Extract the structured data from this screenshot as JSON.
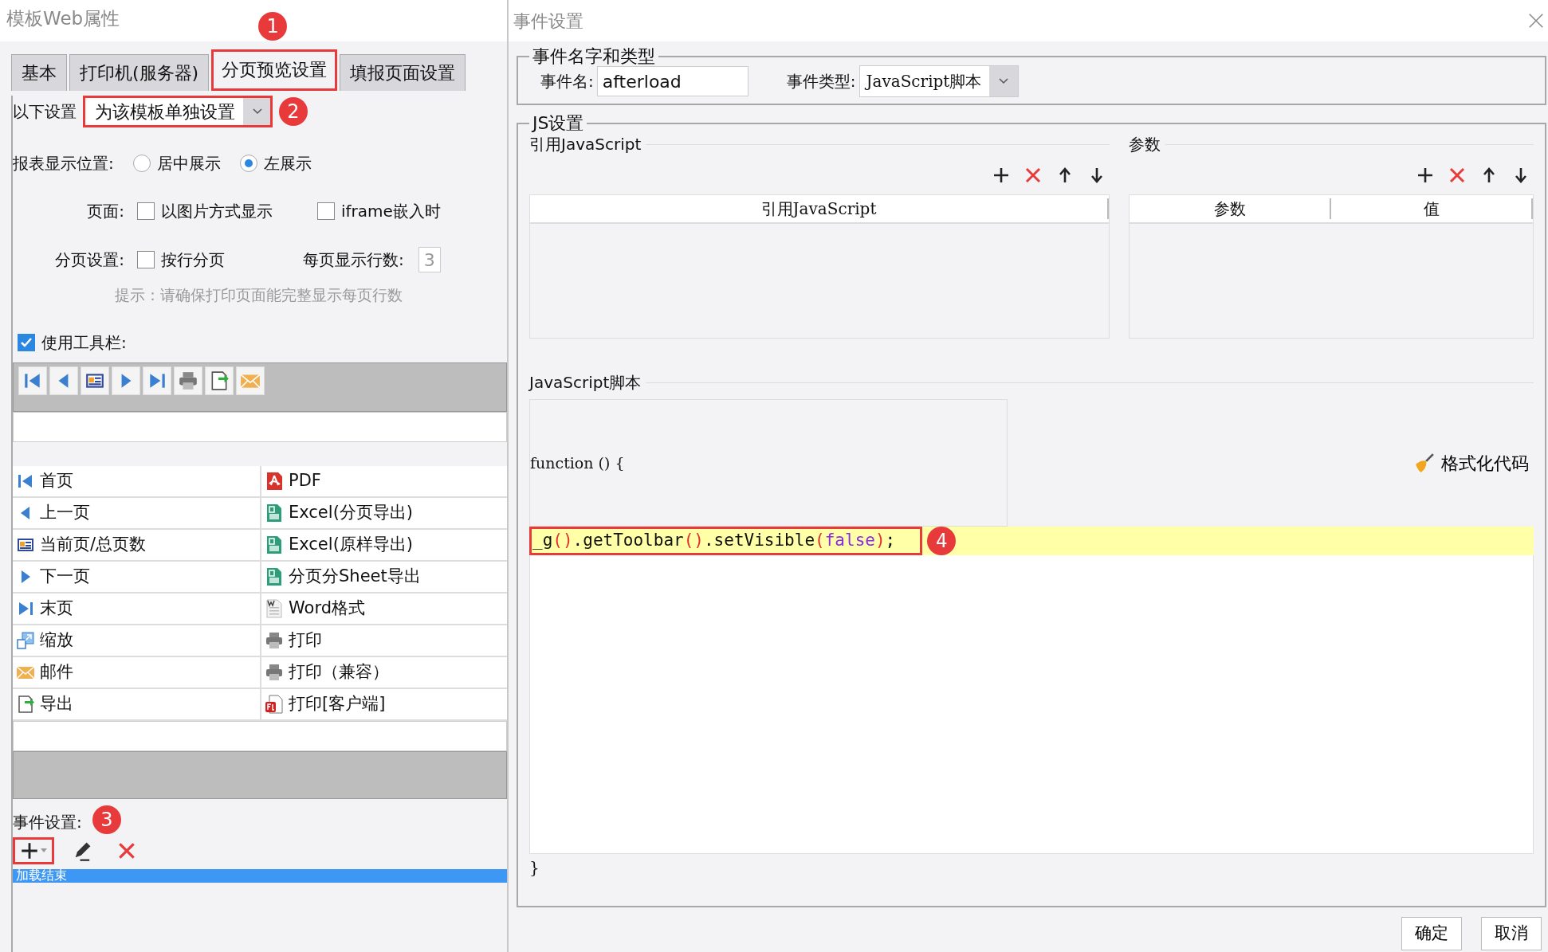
{
  "left_panel": {
    "title": "模板Web属性",
    "tabs": [
      {
        "label": "基本",
        "selected": false,
        "highlighted": false
      },
      {
        "label": "打印机(服务器)",
        "selected": false,
        "highlighted": false
      },
      {
        "label": "分页预览设置",
        "selected": true,
        "highlighted": true,
        "badge": "1"
      },
      {
        "label": "填报页面设置",
        "selected": false,
        "highlighted": false
      }
    ],
    "settings_for": {
      "label": "以下设置",
      "value": "为该模板单独设置",
      "highlighted": true,
      "badge": "2"
    },
    "display_position": {
      "label": "报表显示位置:",
      "options": [
        {
          "label": "居中展示",
          "selected": false
        },
        {
          "label": "左展示",
          "selected": true
        }
      ]
    },
    "page": {
      "label": "页面:",
      "options": [
        {
          "label": "以图片方式显示",
          "checked": false
        },
        {
          "label": "iframe嵌入时",
          "checked": false
        }
      ]
    },
    "paging": {
      "label": "分页设置:",
      "option": {
        "label": "按行分页",
        "checked": false
      },
      "rows_label": "每页显示行数:",
      "rows_value": "3"
    },
    "hint": "提示：请确保打印页面能完整显示每页行数",
    "use_toolbar": {
      "label": "使用工具栏:",
      "checked": true
    },
    "toolbar_preview": [
      {
        "kind": "first"
      },
      {
        "kind": "prev"
      },
      {
        "kind": "page"
      },
      {
        "kind": "next"
      },
      {
        "kind": "last"
      },
      {
        "kind": "print"
      },
      {
        "kind": "export"
      },
      {
        "kind": "email"
      }
    ],
    "toolbar_items_left": [
      {
        "kind": "first",
        "label": "首页"
      },
      {
        "kind": "prev",
        "label": "上一页"
      },
      {
        "kind": "page",
        "label": "当前页/总页数"
      },
      {
        "kind": "next",
        "label": "下一页"
      },
      {
        "kind": "last",
        "label": "末页"
      },
      {
        "kind": "zoom",
        "label": "缩放"
      },
      {
        "kind": "email",
        "label": "邮件"
      },
      {
        "kind": "export",
        "label": "导出"
      }
    ],
    "toolbar_items_right": [
      {
        "kind": "pdf",
        "label": "PDF"
      },
      {
        "kind": "excel",
        "label": "Excel(分页导出)"
      },
      {
        "kind": "excel",
        "label": "Excel(原样导出)"
      },
      {
        "kind": "excel",
        "label": "分页分Sheet导出"
      },
      {
        "kind": "word",
        "label": "Word格式"
      },
      {
        "kind": "print",
        "label": "打印"
      },
      {
        "kind": "print",
        "label": "打印（兼容）"
      },
      {
        "kind": "flash",
        "label": "打印[客户端]"
      }
    ],
    "events": {
      "label": "事件设置:",
      "badge": "3",
      "add_highlighted": true,
      "items": [
        {
          "label": "加载结束",
          "selected": true
        }
      ]
    }
  },
  "dialog": {
    "title": "事件设置",
    "name_type": {
      "legend": "事件名字和类型",
      "name_label": "事件名:",
      "name_value": "afterload",
      "type_label": "事件类型:",
      "type_value": "JavaScript脚本"
    },
    "js": {
      "legend": "JS设置",
      "imports": {
        "title": "引用JavaScript",
        "columns": [
          "引用JavaScript"
        ]
      },
      "params": {
        "title": "参数",
        "columns": [
          "参数",
          "值"
        ]
      },
      "script_label": "JavaScript脚本",
      "code_head": "function () {",
      "format_button": "格式化代码",
      "code_line": [
        {
          "kind": "plain",
          "text": "_g"
        },
        {
          "kind": "paren",
          "text": "()"
        },
        {
          "kind": "plain",
          "text": ".getToolbar"
        },
        {
          "kind": "paren",
          "text": "()"
        },
        {
          "kind": "plain",
          "text": ".setVisible"
        },
        {
          "kind": "paren",
          "text": "("
        },
        {
          "kind": "keyword",
          "text": "false"
        },
        {
          "kind": "paren",
          "text": ")"
        },
        {
          "kind": "plain",
          "text": ";"
        }
      ],
      "code_highlighted": true,
      "badge": "4",
      "code_tail": "}"
    },
    "buttons": [
      "确定",
      "取消"
    ]
  }
}
